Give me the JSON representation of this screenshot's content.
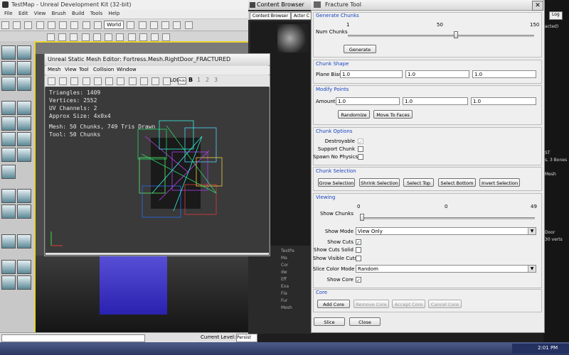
{
  "udk": {
    "title": "TestMap - Unreal Development Kit (32-bit)",
    "menu": [
      "File",
      "Edit",
      "View",
      "Brush",
      "Build",
      "Tools",
      "Help"
    ],
    "world_select": "World",
    "status_level_label": "Current Level:",
    "status_level_value": "Persist"
  },
  "content_browser": {
    "title": "Content Browser",
    "tabs": [
      "Content Browser",
      "Actor C"
    ],
    "tree": [
      "TestPa",
      "Ma",
      "Cor",
      "dw",
      "Eff",
      "Exa",
      "Fla",
      "Fur",
      "Mesh"
    ]
  },
  "right_panel": {
    "tab": "Log",
    "partial_text": [
      "acted)",
      "ST",
      "s, 3 Bones",
      "Mesh",
      "Door",
      "30 verts"
    ]
  },
  "mesh_editor": {
    "title": "Unreal Static Mesh Editor: Fortress.Mesh.RightDoor_FRACTURED",
    "menu": [
      "Mesh",
      "View",
      "Tool",
      "Collision",
      "Window"
    ],
    "toolbar": {
      "lod_label": "LOD:",
      "lod_value": "Auto",
      "numbers": [
        "1",
        "2",
        "3"
      ],
      "bold_b": "B"
    },
    "stats": {
      "triangles": "Triangles:  1409",
      "vertices": "Vertices:  2552",
      "uv_channels": "UV Channels:  2",
      "approx_size": "Approx Size:  4x0x4",
      "mesh": "Mesh: 50 Chunks, 749 Tris Drawn",
      "tool": "Tool: 50 Chunks"
    }
  },
  "fracture_tool": {
    "title": "Fracture Tool",
    "generate_chunks": {
      "heading": "Generate Chunks",
      "num_chunks_label": "Num Chunks",
      "slider_min": "1",
      "slider_mid": "50",
      "slider_max": "150",
      "slider_value_fraction": 0.58,
      "generate_button": "Generate"
    },
    "chunk_shape": {
      "heading": "Chunk Shape",
      "plane_bias_label": "Plane Bias",
      "values": [
        "1.0",
        "1.0",
        "1.0"
      ]
    },
    "modify_points": {
      "heading": "Modify Points",
      "amount_label": "Amount",
      "values": [
        "1.0",
        "1.0",
        "1.0"
      ],
      "randomize_button": "Randomize",
      "move_to_faces_button": "Move To Faces"
    },
    "chunk_options": {
      "heading": "Chunk Options",
      "destroyable_label": "Destroyable",
      "support_chunk_label": "Support Chunk",
      "spawn_no_physics_label": "Spawn No Physics"
    },
    "chunk_selection": {
      "heading": "Chunk Selection",
      "buttons": [
        "Grow Selection",
        "Shrink Selection",
        "Select Top",
        "Select Bottom",
        "Invert Selection"
      ]
    },
    "viewing": {
      "heading": "Viewing",
      "show_chunks_label": "Show Chunks",
      "slider_min": "0",
      "slider_mid": "0",
      "slider_max": "49",
      "slider_value_fraction": 0.0,
      "show_mode_label": "Show Mode",
      "show_mode_value": "View Only",
      "show_cuts_label": "Show Cuts",
      "show_cuts_solid_label": "Show Cuts Solid",
      "show_visible_cuts_label": "Show Visible Cuts",
      "slice_color_mode_label": "Slice Color Mode",
      "slice_color_mode_value": "Random",
      "show_core_label": "Show Core"
    },
    "core": {
      "heading": "Core",
      "buttons": [
        "Add Core",
        "Remove Core",
        "Accept Core",
        "Cancel Core"
      ]
    },
    "slice_button": "Slice",
    "close_button": "Close"
  },
  "taskbar": {
    "clock": "2:01 PM"
  },
  "colors": {
    "group_heading": "#1a44c0",
    "viewport_bg": "#3a3a3a",
    "check_green": "#2a6e2a"
  }
}
